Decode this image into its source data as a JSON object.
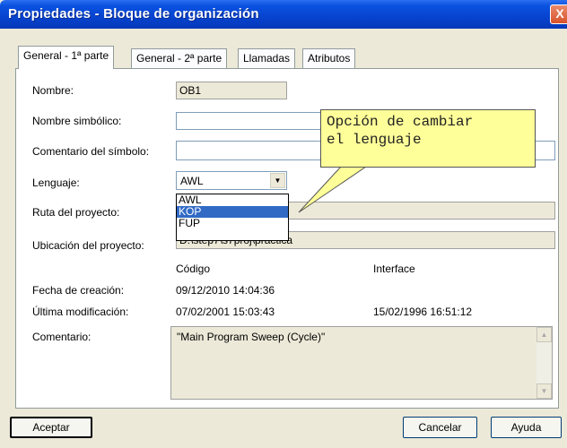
{
  "window": {
    "title": "Propiedades - Bloque de organización",
    "close_glyph": "X"
  },
  "tabs": [
    {
      "label": "General - 1ª parte",
      "active": true
    },
    {
      "label": "General - 2ª parte",
      "active": false
    },
    {
      "label": "Llamadas",
      "active": false
    },
    {
      "label": "Atributos",
      "active": false
    }
  ],
  "fields": {
    "nombre": {
      "label": "Nombre:",
      "value": "OB1"
    },
    "nombre_simbolico": {
      "label": "Nombre simbólico:",
      "value": ""
    },
    "comentario_simbolo": {
      "label": "Comentario del símbolo:",
      "value": ""
    },
    "lenguaje": {
      "label": "Lenguaje:",
      "value": "AWL",
      "options": [
        "AWL",
        "KOP",
        "FUP"
      ],
      "highlighted": "KOP"
    },
    "ruta": {
      "label": "Ruta del proyecto:",
      "value": ""
    },
    "ubicacion": {
      "label": "Ubicación del proyecto:",
      "value": "D:\\step7\\s7proj\\practica"
    }
  },
  "dates": {
    "col_codigo": "Código",
    "col_interface": "Interface",
    "creacion_label": "Fecha de creación:",
    "creacion_codigo": "09/12/2010 14:04:36",
    "modificacion_label": "Última modificación:",
    "modificacion_codigo": "07/02/2001 15:03:43",
    "modificacion_interface": "15/02/1996 16:51:12"
  },
  "comentario": {
    "label": "Comentario:",
    "value": "\"Main Program Sweep (Cycle)\""
  },
  "callout": {
    "line1": "Opción de cambiar",
    "line2": "el lenguaje"
  },
  "buttons": {
    "aceptar": "Aceptar",
    "cancelar": "Cancelar",
    "ayuda": "Ayuda"
  }
}
